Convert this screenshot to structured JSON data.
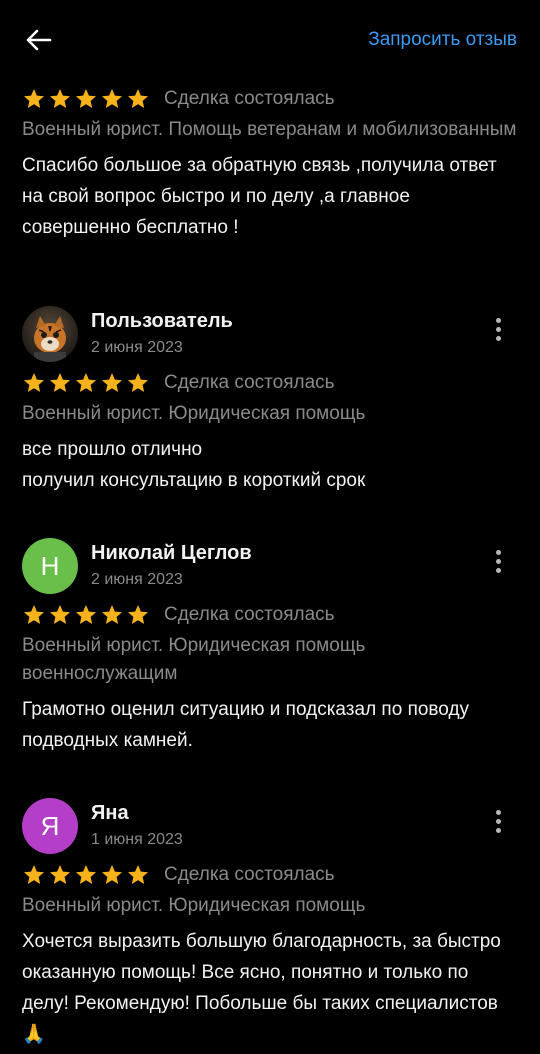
{
  "header": {
    "request_review_label": "Запросить отзыв"
  },
  "colors": {
    "star": "#f5b21b",
    "link": "#3b9bf0",
    "avatar_nikolay": "#6abf4a",
    "avatar_yana": "#b43ec8"
  },
  "reviews": [
    {
      "rating": 5,
      "status": "Сделка состоялась",
      "service": "Военный юрист. Помощь ветеранам и мобилизованным",
      "text": "Спасибо большое за обратную связь ,получила ответ на свой вопрос быстро и по делу ,а главное совершенно бесплатно !"
    },
    {
      "author": "Пользователь",
      "date": "2 июня 2023",
      "avatar": "tiger-photo",
      "rating": 5,
      "status": "Сделка состоялась",
      "service": "Военный юрист. Юридическая помощь",
      "text": "все прошло отлично\nполучил консультацию в короткий срок"
    },
    {
      "author": "Николай Цеглов",
      "date": "2 июня 2023",
      "avatar_letter": "Н",
      "rating": 5,
      "status": "Сделка состоялась",
      "service": "Военный юрист. Юридическая помощь военнослужащим",
      "text": "Грамотно оценил ситуацию и подсказал по поводу подводных камней."
    },
    {
      "author": "Яна",
      "date": "1 июня 2023",
      "avatar_letter": "Я",
      "rating": 5,
      "status": "Сделка состоялась",
      "service": "Военный юрист. Юридическая помощь",
      "text": "Хочется выразить большую благодарность, за быстро оказанную помощь! Все ясно, понятно и только по делу! Рекомендую! Побольше бы таких специалистов 🙏"
    }
  ]
}
